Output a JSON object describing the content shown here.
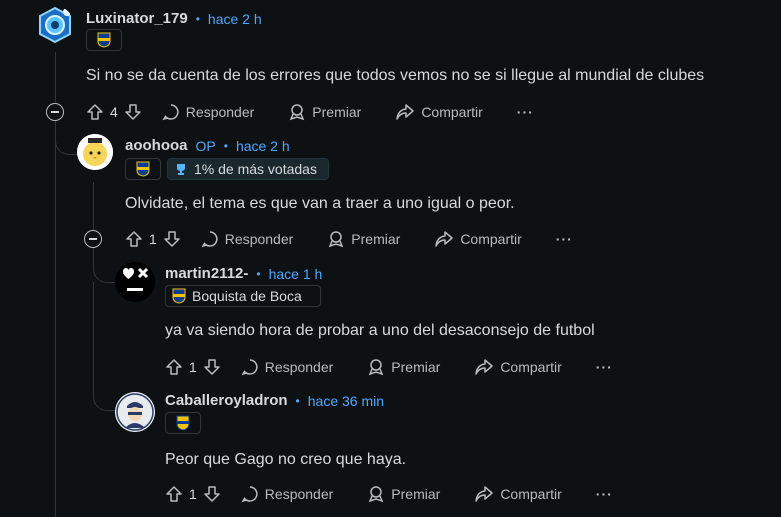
{
  "colors": {
    "background": "#0e1113",
    "link_blue": "#4fa8ff",
    "text": "#d7dadc",
    "muted": "#b8bcbf",
    "thread_line": "#343536"
  },
  "comments": [
    {
      "username": "Luxinator_179",
      "time": "hace 2 h",
      "flair_icon": "boca-crest-icon",
      "text": "Si no se da cuenta de los errores que todos vemos no se si llegue al mundial de clubes",
      "votes": "4"
    },
    {
      "username": "aoohooa",
      "op_label": "OP",
      "time": "hace 2 h",
      "flair_text": "1% de más votadas",
      "text": "Olvidate, el tema es que van a traer a uno igual o peor.",
      "votes": "1"
    },
    {
      "username": "martin2112-",
      "time": "hace 1 h",
      "flair_text": "Boquista de Boca",
      "text": "ya va siendo hora de probar a uno del desaconsejo de futbol",
      "votes": "1"
    },
    {
      "username": "Caballeroyladron",
      "time": "hace 36 min",
      "flair_icon": "boca-crest-icon",
      "text": "Peor que Gago no creo que haya.",
      "votes": "1"
    }
  ],
  "actions": {
    "reply": "Responder",
    "award": "Premiar",
    "share": "Compartir",
    "more": "···"
  }
}
